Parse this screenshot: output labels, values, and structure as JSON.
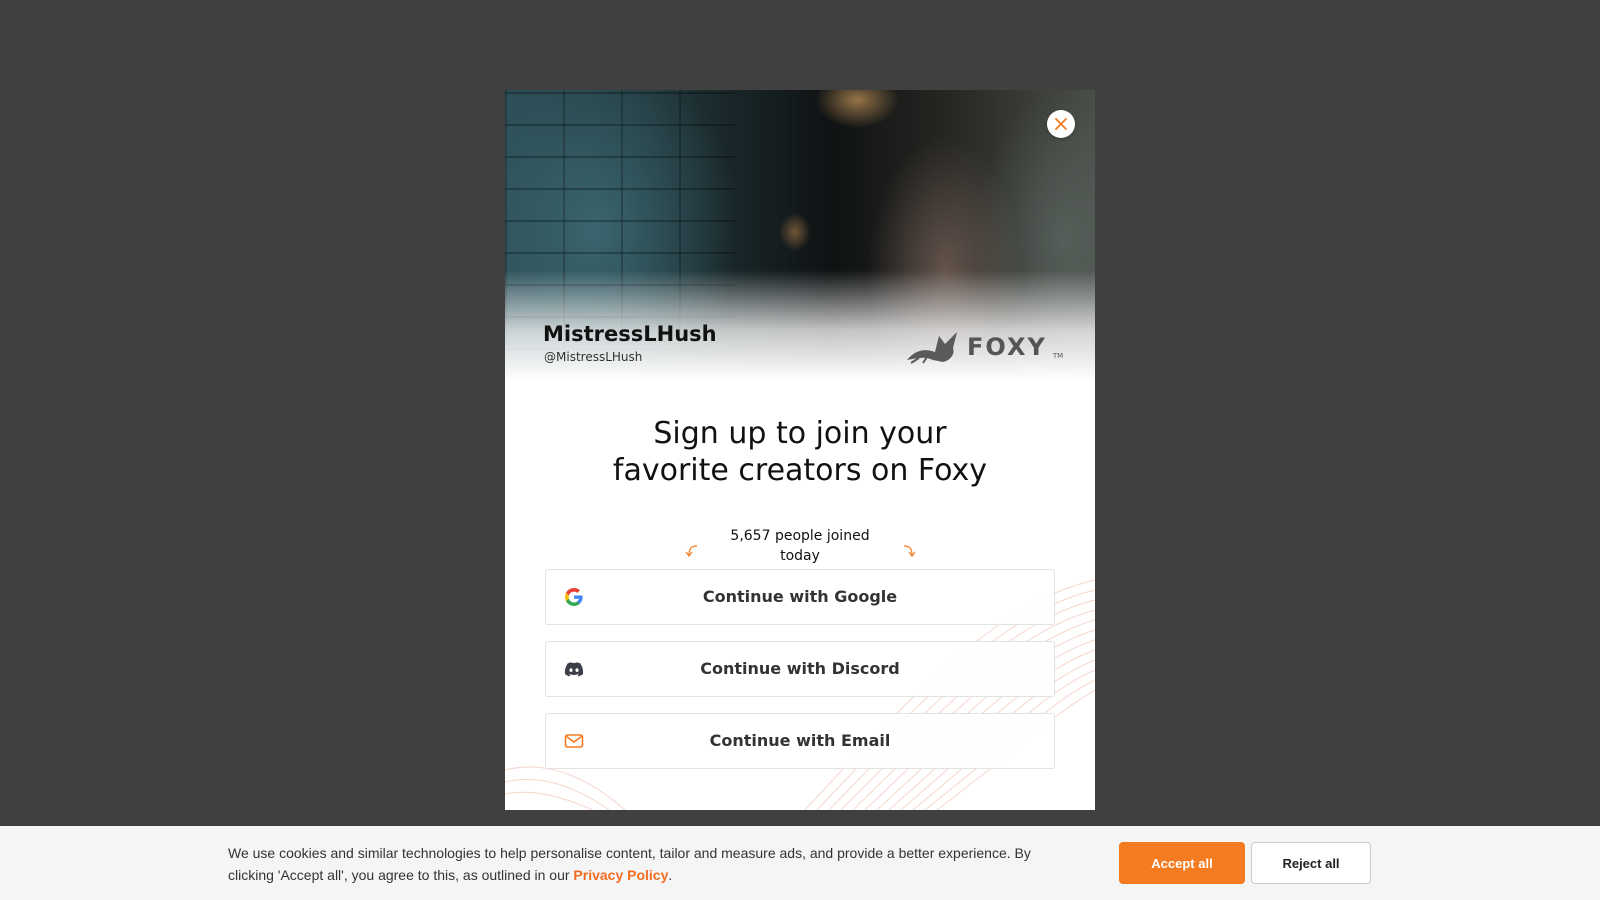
{
  "modal": {
    "creator": {
      "name": "MistressLHush",
      "handle": "@MistressLHush"
    },
    "brand": {
      "logo_text": "FOXY",
      "trademark": "TM"
    },
    "headline": {
      "line1": "Sign up to join your",
      "line2": "favorite creators on Foxy"
    },
    "joined_text": {
      "line1": "5,657 people joined",
      "line2": "today"
    },
    "buttons": {
      "google": "Continue with Google",
      "discord": "Continue with Discord",
      "email": "Continue with Email"
    },
    "icons": {
      "close": "close-icon",
      "google": "google-icon",
      "discord": "discord-icon",
      "email": "mail-icon"
    }
  },
  "cookie_banner": {
    "text": "We use cookies and similar technologies to help personalise content, tailor and measure ads, and provide a better experience. By clicking 'Accept all', you agree to this, as outlined in our",
    "link": "Privacy Policy",
    "end": ".",
    "accept": "Accept all",
    "reject": "Reject all"
  },
  "colors": {
    "backdrop": "#404040",
    "accent": "#f47b20",
    "link": "#f26d21"
  }
}
